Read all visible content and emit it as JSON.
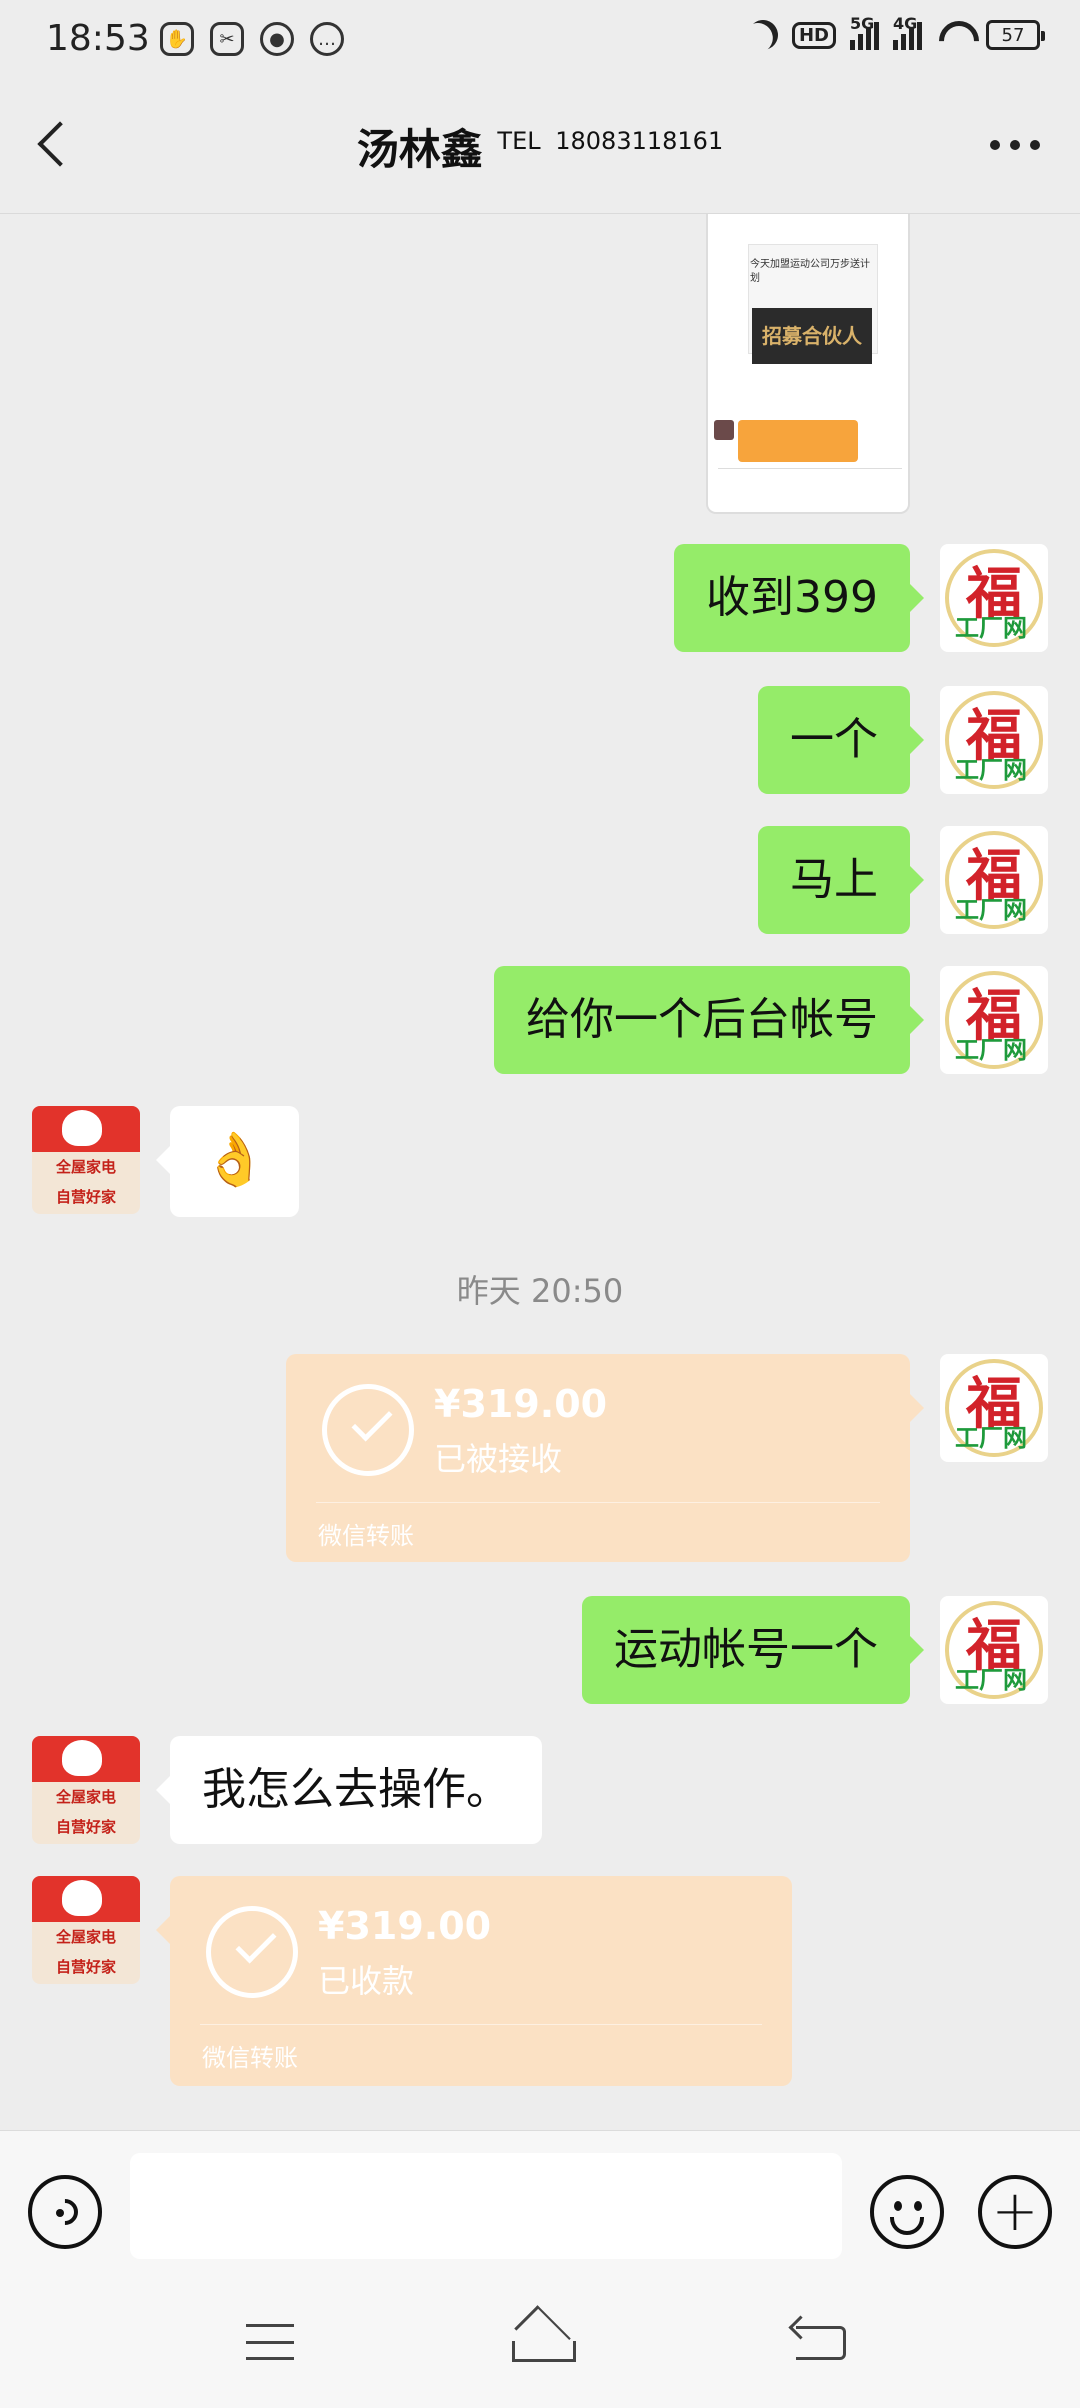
{
  "status_bar": {
    "time": "18:53",
    "hd_label": "HD",
    "net1": "5G",
    "net2": "4G",
    "battery": "57"
  },
  "header": {
    "name": "汤林鑫",
    "tel_label": "TEL",
    "phone": "18083118161"
  },
  "screenshot_preview": {
    "banner_text": "招募合伙人",
    "text": "今天加盟运动公司万步送计划"
  },
  "messages": {
    "m1": "收到399",
    "m2": "一个",
    "m3": "马上",
    "m4": "给你一个后台帐号",
    "m5_emoji": "👌",
    "timestamp": "昨天 20:50",
    "t1_amount": "¥319.00",
    "t1_status": "已被接收",
    "t1_footer": "微信转账",
    "m6": "运动帐号一个",
    "m7": "我怎么去操作。",
    "t2_amount": "¥319.00",
    "t2_status": "已收款",
    "t2_footer": "微信转账"
  },
  "avatars": {
    "me_char": "福",
    "me_sub": "工厂网",
    "other_line1": "全屋家电",
    "other_line2": "自营好家"
  },
  "input": {
    "value": "",
    "plus": "+"
  },
  "colors": {
    "my_bubble": "#95ec69",
    "transfer": "#fbe1c4",
    "background": "#ededed"
  }
}
